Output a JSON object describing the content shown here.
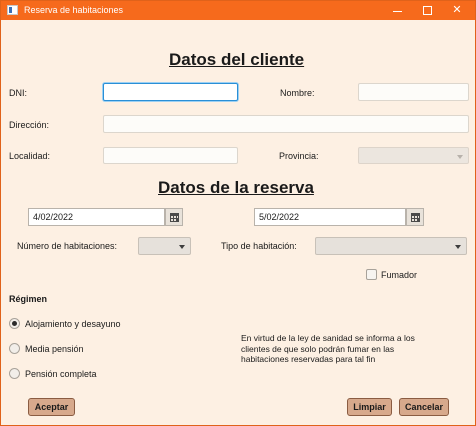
{
  "window": {
    "title": "Reserva de habitaciones"
  },
  "cliente": {
    "heading": "Datos del cliente",
    "dni_label": "DNI:",
    "dni_value": "",
    "nombre_label": "Nombre:",
    "nombre_value": "",
    "direccion_label": "Dirección:",
    "direccion_value": "",
    "localidad_label": "Localidad:",
    "localidad_value": "",
    "provincia_label": "Provincia:",
    "provincia_value": ""
  },
  "reserva": {
    "heading": "Datos de la reserva",
    "fecha_entrada": "4/02/2022",
    "fecha_salida": "5/02/2022",
    "num_habitaciones_label": "Número de habitaciones:",
    "num_habitaciones_value": "",
    "tipo_habitacion_label": "Tipo de habitación:",
    "tipo_habitacion_value": "",
    "fumador_label": "Fumador",
    "fumador_checked": false
  },
  "regimen": {
    "heading": "Régimen",
    "options": [
      {
        "label": "Alojamiento y desayuno",
        "selected": true
      },
      {
        "label": "Media pensión",
        "selected": false
      },
      {
        "label": "Pensión completa",
        "selected": false
      }
    ]
  },
  "info_text": "En virtud de la ley de sanidad se informa a los clientes de que solo podrán fumar en las habitaciones reservadas para tal fin",
  "buttons": {
    "accept": "Aceptar",
    "clear": "Limpiar",
    "cancel": "Cancelar"
  },
  "colors": {
    "titlebar": "#f66a1c",
    "background": "#fdf0e3",
    "button": "#d7a98c",
    "focus": "#2a8fd6"
  },
  "icons": {
    "app": "window-app-icon",
    "calendar": "calendar-icon",
    "dropdown": "chevron-down-icon"
  }
}
